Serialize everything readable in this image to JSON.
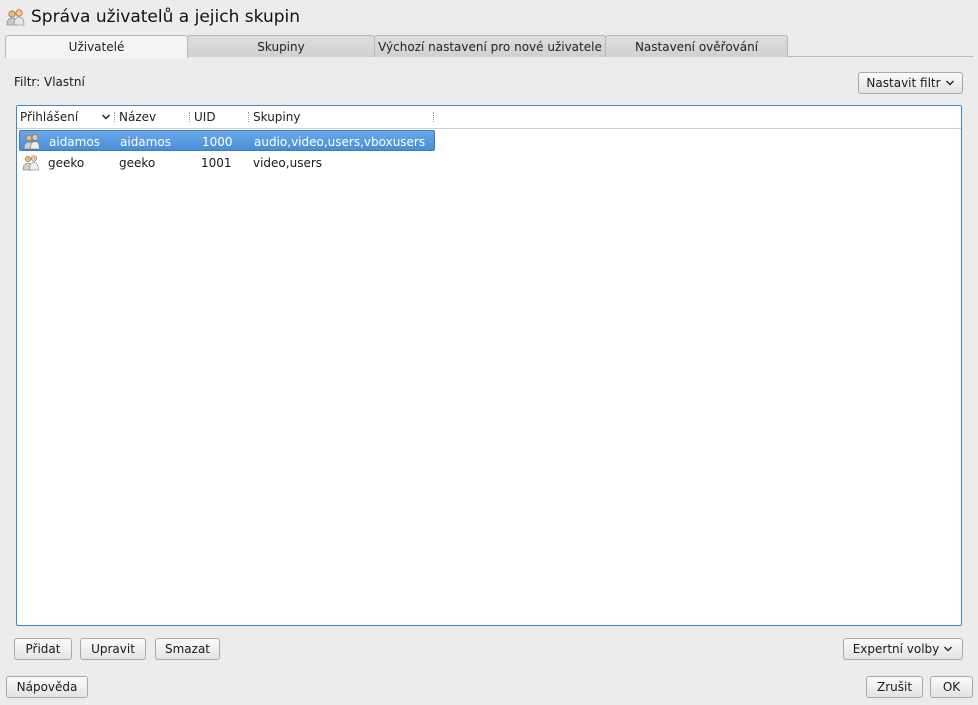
{
  "window": {
    "title": "Správa uživatelů a jejich skupin",
    "icon": "users-group-icon"
  },
  "tabs": [
    {
      "label": "Uživatelé",
      "active": true
    },
    {
      "label": "Skupiny",
      "active": false
    },
    {
      "label": "Výchozí nastavení pro nové uživatele",
      "active": false
    },
    {
      "label": "Nastavení ověřování",
      "active": false
    }
  ],
  "filter": {
    "label": "Filtr: Vlastní",
    "button": "Nastavit filtr"
  },
  "table": {
    "columns": [
      "Přihlášení",
      "Název",
      "UID",
      "Skupiny"
    ],
    "sort_column": "Přihlášení",
    "rows": [
      {
        "login": "aidamos",
        "name": "aidamos",
        "uid": "1000",
        "groups": "audio,video,users,vboxusers",
        "selected": true
      },
      {
        "login": "geeko",
        "name": "geeko",
        "uid": "1001",
        "groups": "video,users",
        "selected": false
      }
    ]
  },
  "actions": {
    "add": "Přidat",
    "edit": "Upravit",
    "delete": "Smazat",
    "expert": "Expertní volby"
  },
  "footer": {
    "help": "Nápověda",
    "cancel": "Zrušit",
    "ok": "OK"
  },
  "colors": {
    "selection": "#4a8edb",
    "table_border": "#3d86d3",
    "background": "#ececec"
  }
}
